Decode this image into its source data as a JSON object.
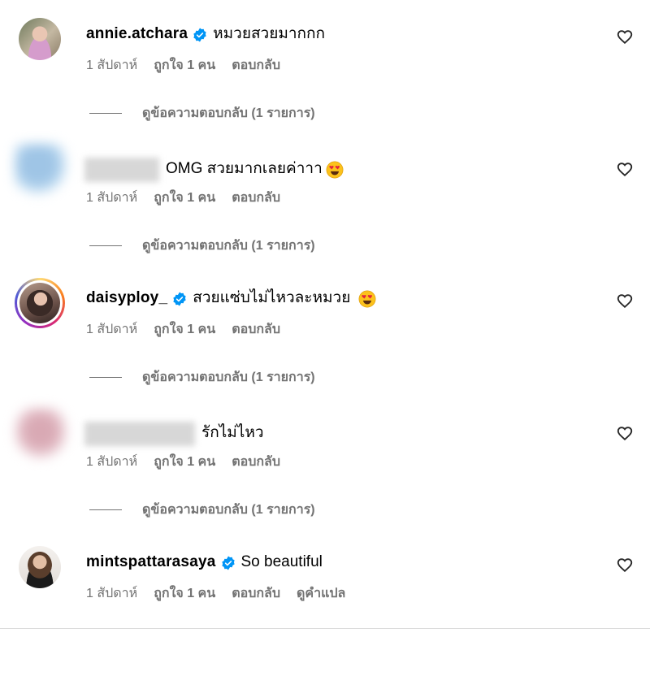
{
  "comments": [
    {
      "username": "annie.atchara",
      "verified": true,
      "text": "หมวยสวยมากกก",
      "time": "1 สัปดาห์",
      "likes": "ถูกใจ 1 คน",
      "reply_label": "ตอบกลับ",
      "view_replies": "ดูข้อความตอบกลับ (1 รายการ)"
    },
    {
      "username_hidden": true,
      "text": "OMG สวยมากเลยค่าาา",
      "emoji": "heart-eyes",
      "time": "1 สัปดาห์",
      "likes": "ถูกใจ 1 คน",
      "reply_label": "ตอบกลับ",
      "view_replies": "ดูข้อความตอบกลับ (1 รายการ)"
    },
    {
      "username": "daisyploy_",
      "verified": true,
      "text": "สวยแซ่บไม่ไหวละหมวย",
      "emoji": "heart-eyes",
      "time": "1 สัปดาห์",
      "likes": "ถูกใจ 1 คน",
      "reply_label": "ตอบกลับ",
      "view_replies": "ดูข้อความตอบกลับ (1 รายการ)"
    },
    {
      "username_hidden": true,
      "text": "รักไม่ไหว",
      "time": "1 สัปดาห์",
      "likes": "ถูกใจ 1 คน",
      "reply_label": "ตอบกลับ",
      "view_replies": "ดูข้อความตอบกลับ (1 รายการ)"
    },
    {
      "username": "mintspattarasaya",
      "verified": true,
      "text": "So beautiful",
      "time": "1 สัปดาห์",
      "likes": "ถูกใจ 1 คน",
      "reply_label": "ตอบกลับ",
      "translate_label": "ดูคำแปล"
    }
  ],
  "colors": {
    "verified_blue": "#0095f6",
    "secondary_text": "#737373"
  },
  "icons": {
    "like": "heart-outline-icon",
    "verified": "verified-badge-icon"
  }
}
